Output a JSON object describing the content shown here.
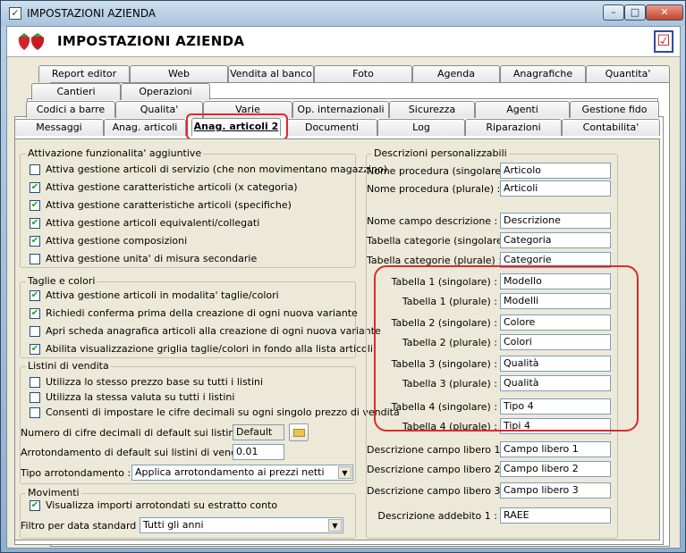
{
  "window": {
    "title": "IMPOSTAZIONI AZIENDA",
    "header_title": "IMPOSTAZIONI AZIENDA"
  },
  "tabs": {
    "row1": [
      "Report editor",
      "Web",
      "Vendita al banco",
      "Foto",
      "Agenda",
      "Anagrafiche",
      "Quantita'"
    ],
    "row2": [
      "Cantieri",
      "Operazioni"
    ],
    "row3": [
      "Codici a barre",
      "Qualita'",
      "Varie",
      "Op. internazionali",
      "Sicurezza",
      "Agenti",
      "Gestione fido"
    ],
    "row4": [
      "Messaggi",
      "Anag. articoli",
      "Anag. articoli 2",
      "Documenti",
      "Log",
      "Riparazioni",
      "Contabilita'"
    ]
  },
  "attivazione": {
    "title": "Attivazione funzionalita' aggiuntive",
    "items": [
      {
        "label": "Attiva gestione articoli di servizio (che non movimentano magazzino)",
        "checked": false
      },
      {
        "label": "Attiva gestione caratteristiche articoli (x categoria)",
        "checked": true
      },
      {
        "label": "Attiva gestione caratteristiche articoli (specifiche)",
        "checked": true
      },
      {
        "label": "Attiva gestione articoli equivalenti/collegati",
        "checked": true
      },
      {
        "label": "Attiva gestione composizioni",
        "checked": true
      },
      {
        "label": "Attiva gestione unita' di misura secondarie",
        "checked": false
      }
    ]
  },
  "taglie": {
    "title": "Taglie e colori",
    "items": [
      {
        "label": "Attiva gestione articoli in modalita' taglie/colori",
        "checked": true
      },
      {
        "label": "Richiedi conferma prima della creazione di ogni nuova variante",
        "checked": true
      },
      {
        "label": "Apri scheda anagrafica articoli alla creazione di ogni nuova variante",
        "checked": false
      },
      {
        "label": "Abilita visualizzazione griglia taglie/colori in fondo alla lista articoli",
        "checked": true
      }
    ]
  },
  "listini": {
    "title": "Listini di vendita",
    "items": [
      {
        "label": "Utilizza lo stesso prezzo base su tutti i listini",
        "checked": false
      },
      {
        "label": "Utilizza la stessa valuta su tutti i listini",
        "checked": false
      },
      {
        "label": "Consenti di impostare le cifre decimali su ogni singolo prezzo di vendita",
        "checked": false
      }
    ],
    "decimali_label": "Numero di cifre decimali di default sui listini :",
    "decimali_value": "Default",
    "arrot_label": "Arrotondamento di default sui listini di vendita :",
    "arrot_value": "0.01",
    "tipo_label": "Tipo arrotondamento :",
    "tipo_value": "Applica arrotondamento ai prezzi netti"
  },
  "movimenti": {
    "title": "Movimenti",
    "items": [
      {
        "label": "Visualizza importi arrotondati su estratto conto",
        "checked": true
      }
    ],
    "filtro_label": "Filtro per data standard :",
    "filtro_value": "Tutti gli anni"
  },
  "descrizioni": {
    "title": "Descrizioni personalizzabili",
    "fields": [
      {
        "label": "Nome procedura (singolare) :",
        "value": "Articolo"
      },
      {
        "label": "Nome procedura (plurale) :",
        "value": "Articoli"
      },
      {
        "label": "Nome campo descrizione :",
        "value": "Descrizione"
      },
      {
        "label": "Tabella categorie (singolare) :",
        "value": "Categoria"
      },
      {
        "label": "Tabella categorie (plurale) :",
        "value": "Categorie"
      },
      {
        "label": "Tabella 1 (singolare) :",
        "value": "Modello"
      },
      {
        "label": "Tabella 1 (plurale) :",
        "value": "Modelli"
      },
      {
        "label": "Tabella 2 (singolare) :",
        "value": "Colore"
      },
      {
        "label": "Tabella 2 (plurale) :",
        "value": "Colori"
      },
      {
        "label": "Tabella 3 (singolare) :",
        "value": "Qualità"
      },
      {
        "label": "Tabella 3 (plurale) :",
        "value": "Qualità"
      },
      {
        "label": "Tabella 4 (singolare) :",
        "value": "Tipo 4"
      },
      {
        "label": "Tabella 4 (plurale) :",
        "value": "Tipi 4"
      },
      {
        "label": "Descrizione campo libero 1 :",
        "value": "Campo libero 1"
      },
      {
        "label": "Descrizione campo libero 2 :",
        "value": "Campo libero 2"
      },
      {
        "label": "Descrizione campo libero 3 :",
        "value": "Campo libero 3"
      },
      {
        "label": "Descrizione addebito 1 :",
        "value": "RAEE"
      }
    ]
  }
}
